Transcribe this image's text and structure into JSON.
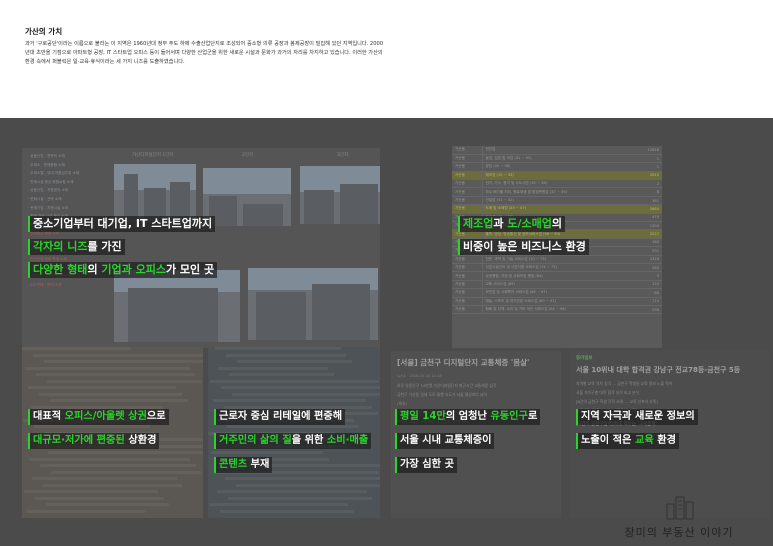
{
  "intro": {
    "title": "가산의 가치",
    "body": "과거 '구로공단'이라는 이름으로 불리는 이 지역은 1960년대 정부 주도 하에 수출산업단지로 조성되어 중소형 의류 공장과 봉제공장이 밀집해 있던 지역입니다. 2000년대 초반을 기점으로 아파트형 공장, IT 스타트업 오피스 등이 들어서며 다양한 산업군을 위한 새로운 시설과 문화가 과거의 자리를 차지하고 있습니다. 이러한 가산의 환경 속에서 퍼블릭은 일·교육·휴식이라는 세 가지 니즈를 도출하였습니다."
  },
  "captions": {
    "top_left": [
      [
        {
          "t": "중소기업부터 대기업, IT 스타트업까지",
          "g": false
        }
      ],
      [
        {
          "t": "각자의 니즈",
          "g": true
        },
        {
          "t": "를 가진",
          "g": false
        }
      ],
      [
        {
          "t": "다양한 형태",
          "g": true
        },
        {
          "t": "의 ",
          "g": false
        },
        {
          "t": "기업과 오피스",
          "g": true
        },
        {
          "t": "가 모인 곳",
          "g": false
        }
      ]
    ],
    "top_right": [
      [
        {
          "t": "제조업",
          "g": true
        },
        {
          "t": "과 ",
          "g": false
        },
        {
          "t": "도/소매업",
          "g": true
        },
        {
          "t": "의",
          "g": false
        }
      ],
      [
        {
          "t": "비중이 높은 비즈니스 환경",
          "g": false
        }
      ]
    ],
    "bottom_1": [
      [
        {
          "t": "대표적 ",
          "g": false
        },
        {
          "t": "오피스/아울렛 상권",
          "g": true
        },
        {
          "t": "으로",
          "g": false
        }
      ],
      [
        {
          "t": "대규모·저가에 편중된",
          "g": true
        },
        {
          "t": " 상환경",
          "g": false
        }
      ]
    ],
    "bottom_2": [
      [
        {
          "t": "근로자 중심 리테일에 편중해",
          "g": false
        }
      ],
      [
        {
          "t": "거주민의 삶의 질",
          "g": true
        },
        {
          "t": "을 위한 ",
          "g": false
        },
        {
          "t": "소비·매출",
          "g": true
        }
      ],
      [
        {
          "t": "콘텐츠",
          "g": true
        },
        {
          "t": " 부재",
          "g": false
        }
      ]
    ],
    "bottom_3": [
      [
        {
          "t": "평일 14만",
          "g": true
        },
        {
          "t": "의 엄청난 ",
          "g": false
        },
        {
          "t": "유동인구",
          "g": true
        },
        {
          "t": "로",
          "g": false
        }
      ],
      [
        {
          "t": "서울 시내 교통체증이",
          "g": false
        }
      ],
      [
        {
          "t": "가장 심한 곳",
          "g": false
        }
      ]
    ],
    "bottom_4": [
      [
        {
          "t": "지역 자극과 새로운 정보의",
          "g": false
        }
      ],
      [
        {
          "t": "노출이 적은 ",
          "g": false
        },
        {
          "t": "교육",
          "g": true
        },
        {
          "t": " 환경",
          "g": false
        }
      ]
    ]
  },
  "left_list": [
    {
      "t": "공동산업 - 전략의 소재",
      "red": false
    },
    {
      "t": "오피스 - 판매종합 소재",
      "red": false
    },
    {
      "t": "오피스텔 - 임대 지원입주된 소재",
      "red": false
    },
    {
      "t": "판매시설 중심 종합쇼핑 소재",
      "red": false
    },
    {
      "t": "공동산업 - 지원센터 소재",
      "red": false
    },
    {
      "t": "문화시설 - 전략 소재",
      "red": false
    },
    {
      "t": "판매기업 - 지원시설 소재",
      "red": false
    },
    {
      "t": "판매 관련 시설 중심 소재",
      "red": false
    },
    {
      "t": "지식산업센터 - 업무 지원 소재",
      "red": false
    },
    {
      "t": "판매중심 종합 소재",
      "red": true
    },
    {
      "t": "판매산업 중심 - 판매 소재",
      "red": true
    },
    {
      "t": "판매시설 중심 판매 지원",
      "red": true
    },
    {
      "t": "인근산업 종합 판매 소재",
      "red": true
    },
    {
      "t": "판매 지원 시설 - 판매 소재",
      "red": true
    },
    {
      "t": "LG전자 - 지식산업센터 판매 소재",
      "red": true
    },
    {
      "t": "SKT판매 - 판매 소재",
      "red": true
    }
  ],
  "photo_headers": [
    "가산디지털단지 1단지",
    "2단지",
    "3단지"
  ],
  "table_rows": [
    [
      "가산동",
      "전산업",
      "12616",
      false
    ],
    [
      "가산동",
      "농업, 임업 및 어업 (01 ~ 03)",
      "1",
      false
    ],
    [
      "가산동",
      "광업 (05 ~ 08)",
      "1",
      false
    ],
    [
      "가산동",
      "제조업 (10 ~ 33)",
      "2615",
      true
    ],
    [
      "가산동",
      "전기, 가스, 증기 및 수도사업 (35 ~ 36)",
      "2",
      false
    ],
    [
      "가산동",
      "하수·폐기물 처리, 원료재생 및 환경복원업 (37 ~ 39)",
      "8",
      false
    ],
    [
      "가산동",
      "건설업 (41 ~ 42)",
      "361",
      false
    ],
    [
      "가산동",
      "도매 및 소매업 (45 ~ 47)",
      "2884",
      true
    ],
    [
      "가산동",
      "운수업 (49 ~ 52)",
      "479",
      false
    ],
    [
      "가산동",
      "숙박 및 음식점업 (55 ~ 56)",
      "1100",
      false
    ],
    [
      "가산동",
      "출판, 영상, 방송통신 및 정보서비스업 (58 ~ 63)",
      "2027",
      true
    ],
    [
      "가산동",
      "금융 및 보험업 (64 ~ 66)",
      "160",
      false
    ],
    [
      "가산동",
      "부동산업 및 임대업 (68 ~ 69)",
      "291",
      false
    ],
    [
      "가산동",
      "전문, 과학 및 기술 서비스업 (70 ~ 73)",
      "1316",
      false
    ],
    [
      "가산동",
      "사업시설관리 및 사업지원 서비스업 (74 ~ 75)",
      "283",
      false
    ],
    [
      "가산동",
      "공공행정, 국방 및 사회보장 행정 (84)",
      "5",
      false
    ],
    [
      "가산동",
      "교육 서비스업 (85)",
      "124",
      false
    ],
    [
      "가산동",
      "보건업 및 사회복지 서비스업 (86 ~ 87)",
      "88",
      false
    ],
    [
      "가산동",
      "예술, 스포츠 및 여가관련 서비스업 (90 ~ 91)",
      "114",
      false
    ],
    [
      "가산동",
      "협회 및 단체, 수리 및 기타 개인 서비스업 (94 ~ 96)",
      "296",
      false
    ]
  ],
  "news1": {
    "title": "[서울] 금천구 디지털단지 교통체증 '몸살'",
    "sub": "뉴스1 · 2016-10-18 10:18",
    "body_lines": [
      "하루 유동인구 14만명 가산디지털단지 퇴근시간 교통체증 심각",
      "금천구 가산동 일대 도로 통행 속도가 서울 평균보다 낮아",
      "(계속)",
      "가산디지털단지 교통 문제 해결 대책 마련 시급",
      "수도권 서남권 교통체증 가장 심한 곳 중 하나"
    ]
  },
  "news2": {
    "brand": "동아일보",
    "title": "서울 10위내 대학 합격권 강남구 전교78등-금천구 5등",
    "body_lines": [
      "지역별 교육 격차 심각 … 금천구 학생들 교육 정보 노출 적어",
      "서울 자치구별 대학 합격 실적 비교 분석",
      "[6건의 금천구 학생 진학 사례 … 교육 인프라 부족]",
      "교육 정보 접근성 낮아 '교육문제' 지적"
    ],
    "tag": "[6건의 금천구합격]최대 화두는 '교육문제'"
  },
  "logo": {
    "text": "장미의 부동산 이야기"
  }
}
